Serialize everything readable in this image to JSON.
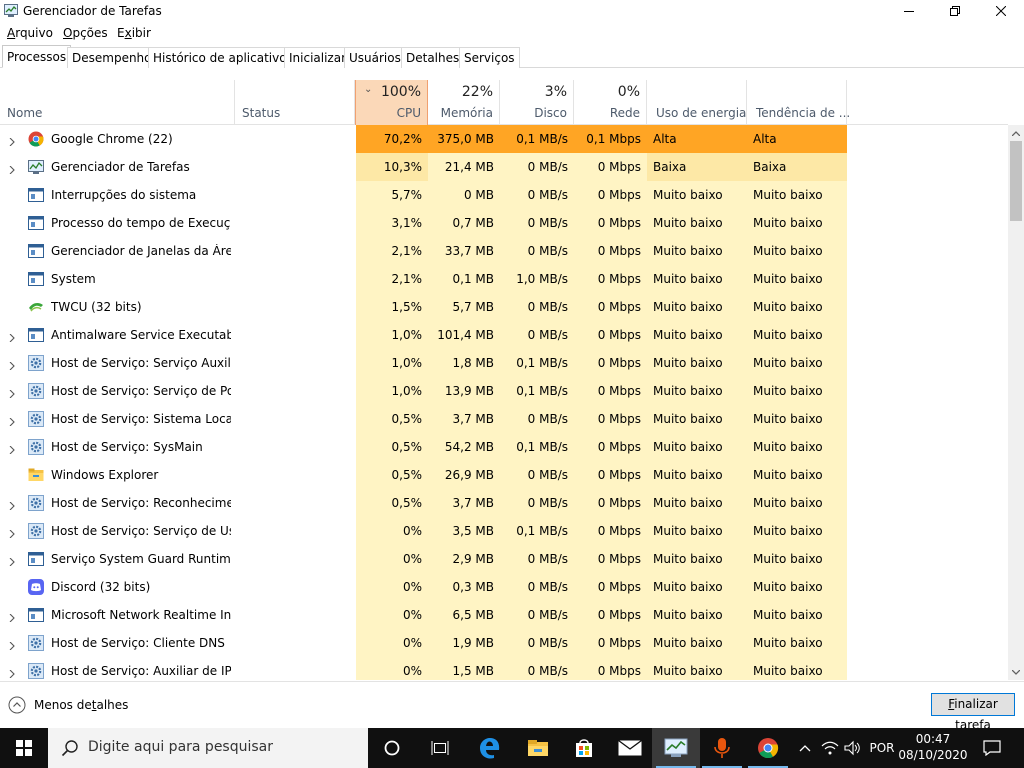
{
  "window": {
    "title": "Gerenciador de Tarefas"
  },
  "menu": [
    {
      "prefix": "",
      "accel": "A",
      "rest": "rquivo"
    },
    {
      "prefix": "",
      "accel": "O",
      "rest": "pções"
    },
    {
      "prefix": "E",
      "accel": "x",
      "rest": "ibir"
    }
  ],
  "tabs": [
    "Processos",
    "Desempenho",
    "Histórico de aplicativos",
    "Inicializar",
    "Usuários",
    "Detalhes",
    "Serviços"
  ],
  "active_tab": 0,
  "columns": {
    "name": "Nome",
    "status": "Status",
    "cpu": {
      "pct": "100%",
      "label": "CPU"
    },
    "memory": {
      "pct": "22%",
      "label": "Memória"
    },
    "disk": {
      "pct": "3%",
      "label": "Disco"
    },
    "network": {
      "pct": "0%",
      "label": "Rede"
    },
    "power": "Uso de energia",
    "power_trend": "Tendência de ..."
  },
  "processes": [
    {
      "name": "Google Chrome (22)",
      "icon": "chrome-icon",
      "expandable": true,
      "cpu": "70,2%",
      "mem": "375,0 MB",
      "disk": "0,1 MB/s",
      "net": "0,1 Mbps",
      "power": "Alta",
      "trend": "Alta",
      "heat": "high"
    },
    {
      "name": "Gerenciador de Tarefas",
      "icon": "task-manager-icon",
      "expandable": true,
      "cpu": "10,3%",
      "mem": "21,4 MB",
      "disk": "0 MB/s",
      "net": "0 Mbps",
      "power": "Baixa",
      "trend": "Baixa",
      "heat": "mid"
    },
    {
      "name": "Interrupções do sistema",
      "icon": "window-icon",
      "expandable": false,
      "cpu": "5,7%",
      "mem": "0 MB",
      "disk": "0 MB/s",
      "net": "0 Mbps",
      "power": "Muito baixo",
      "trend": "Muito baixo",
      "heat": "low"
    },
    {
      "name": "Processo do tempo de Execuçã...",
      "icon": "window-icon",
      "expandable": false,
      "cpu": "3,1%",
      "mem": "0,7 MB",
      "disk": "0 MB/s",
      "net": "0 Mbps",
      "power": "Muito baixo",
      "trend": "Muito baixo",
      "heat": "low"
    },
    {
      "name": "Gerenciador de Janelas da Área ...",
      "icon": "window-icon",
      "expandable": false,
      "cpu": "2,1%",
      "mem": "33,7 MB",
      "disk": "0 MB/s",
      "net": "0 Mbps",
      "power": "Muito baixo",
      "trend": "Muito baixo",
      "heat": "low"
    },
    {
      "name": "System",
      "icon": "window-icon",
      "expandable": false,
      "cpu": "2,1%",
      "mem": "0,1 MB",
      "disk": "1,0 MB/s",
      "net": "0 Mbps",
      "power": "Muito baixo",
      "trend": "Muito baixo",
      "heat": "low"
    },
    {
      "name": "TWCU (32 bits)",
      "icon": "twcu-icon",
      "expandable": false,
      "cpu": "1,5%",
      "mem": "5,7 MB",
      "disk": "0 MB/s",
      "net": "0 Mbps",
      "power": "Muito baixo",
      "trend": "Muito baixo",
      "heat": "low"
    },
    {
      "name": "Antimalware Service Executable",
      "icon": "window-icon",
      "expandable": true,
      "cpu": "1,0%",
      "mem": "101,4 MB",
      "disk": "0 MB/s",
      "net": "0 Mbps",
      "power": "Muito baixo",
      "trend": "Muito baixo",
      "heat": "low"
    },
    {
      "name": "Host de Serviço: Serviço Auxiliar...",
      "icon": "gear-icon",
      "expandable": true,
      "cpu": "1,0%",
      "mem": "1,8 MB",
      "disk": "0,1 MB/s",
      "net": "0 Mbps",
      "power": "Muito baixo",
      "trend": "Muito baixo",
      "heat": "low"
    },
    {
      "name": "Host de Serviço: Serviço de Polít...",
      "icon": "gear-icon",
      "expandable": true,
      "cpu": "1,0%",
      "mem": "13,9 MB",
      "disk": "0,1 MB/s",
      "net": "0 Mbps",
      "power": "Muito baixo",
      "trend": "Muito baixo",
      "heat": "low"
    },
    {
      "name": "Host de Serviço: Sistema Local (...",
      "icon": "gear-icon",
      "expandable": true,
      "cpu": "0,5%",
      "mem": "3,7 MB",
      "disk": "0 MB/s",
      "net": "0 Mbps",
      "power": "Muito baixo",
      "trend": "Muito baixo",
      "heat": "low"
    },
    {
      "name": "Host de Serviço: SysMain",
      "icon": "gear-icon",
      "expandable": true,
      "cpu": "0,5%",
      "mem": "54,2 MB",
      "disk": "0,1 MB/s",
      "net": "0 Mbps",
      "power": "Muito baixo",
      "trend": "Muito baixo",
      "heat": "low"
    },
    {
      "name": "Windows Explorer",
      "icon": "folder-icon",
      "expandable": false,
      "cpu": "0,5%",
      "mem": "26,9 MB",
      "disk": "0 MB/s",
      "net": "0 Mbps",
      "power": "Muito baixo",
      "trend": "Muito baixo",
      "heat": "low"
    },
    {
      "name": "Host de Serviço: Reconhecimen...",
      "icon": "gear-icon",
      "expandable": true,
      "cpu": "0,5%",
      "mem": "3,7 MB",
      "disk": "0 MB/s",
      "net": "0 Mbps",
      "power": "Muito baixo",
      "trend": "Muito baixo",
      "heat": "low"
    },
    {
      "name": "Host de Serviço: Serviço de Usu...",
      "icon": "gear-icon",
      "expandable": true,
      "cpu": "0%",
      "mem": "3,5 MB",
      "disk": "0,1 MB/s",
      "net": "0 Mbps",
      "power": "Muito baixo",
      "trend": "Muito baixo",
      "heat": "none"
    },
    {
      "name": "Serviço System Guard Runtime ...",
      "icon": "window-icon",
      "expandable": true,
      "cpu": "0%",
      "mem": "2,9 MB",
      "disk": "0 MB/s",
      "net": "0 Mbps",
      "power": "Muito baixo",
      "trend": "Muito baixo",
      "heat": "none"
    },
    {
      "name": "Discord (32 bits)",
      "icon": "discord-icon",
      "expandable": false,
      "cpu": "0%",
      "mem": "0,3 MB",
      "disk": "0 MB/s",
      "net": "0 Mbps",
      "power": "Muito baixo",
      "trend": "Muito baixo",
      "heat": "none"
    },
    {
      "name": "Microsoft Network Realtime Ins...",
      "icon": "window-icon",
      "expandable": true,
      "cpu": "0%",
      "mem": "6,5 MB",
      "disk": "0 MB/s",
      "net": "0 Mbps",
      "power": "Muito baixo",
      "trend": "Muito baixo",
      "heat": "none"
    },
    {
      "name": "Host de Serviço: Cliente DNS",
      "icon": "gear-icon",
      "expandable": true,
      "cpu": "0%",
      "mem": "1,9 MB",
      "disk": "0 MB/s",
      "net": "0 Mbps",
      "power": "Muito baixo",
      "trend": "Muito baixo",
      "heat": "none"
    },
    {
      "name": "Host de Serviço: Auxiliar de IP",
      "icon": "gear-icon",
      "expandable": true,
      "cpu": "0%",
      "mem": "1,5 MB",
      "disk": "0 MB/s",
      "net": "0 Mbps",
      "power": "Muito baixo",
      "trend": "Muito baixo",
      "heat": "none"
    }
  ],
  "footer": {
    "less_details": {
      "before": "Menos de",
      "accel": "t",
      "after": "alhes"
    },
    "end_task": {
      "before": "",
      "accel": "F",
      "after": "inalizar tarefa"
    }
  },
  "taskbar": {
    "search_placeholder": "Digite aqui para pesquisar",
    "language": "POR",
    "time": "00:47",
    "date": "08/10/2020"
  },
  "colors": {
    "cpu_header": "#fbd8b8",
    "heat_high": "#ffa524",
    "heat_mid": "#fde8a6",
    "heat_low": "#fff4c4",
    "heat_none": "#fff4c4",
    "accent": "#0078d7"
  }
}
